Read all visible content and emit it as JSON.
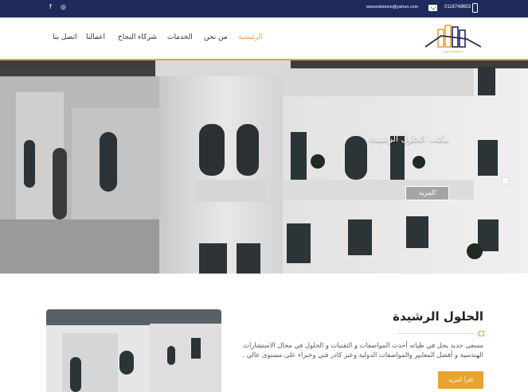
{
  "topbar": {
    "email": "wisesolutions@yahoo.com",
    "phone": "0116748653",
    "social": [
      {
        "icon": "facebook-icon",
        "glyph": "f"
      },
      {
        "icon": "instagram-icon",
        "glyph": "◎"
      }
    ],
    "colors": {
      "background": "#1e2a5c"
    }
  },
  "header": {
    "logo_text": "wise solutions",
    "nav": [
      {
        "label": "الرئيسية",
        "active": true
      },
      {
        "label": "من نحن",
        "active": false
      },
      {
        "label": "الخدمات",
        "active": false
      },
      {
        "label": "شركاء النجاح",
        "active": false
      },
      {
        "label": "اعمالنا",
        "active": false
      },
      {
        "label": "اتصل بنا",
        "active": false
      }
    ],
    "colors": {
      "accent": "#e9a330"
    }
  },
  "hero": {
    "title": "مكتب الحلول الرشيدة",
    "button_label": "المزيد"
  },
  "about": {
    "title": "الحلول الرشيدة",
    "text": "مسعى جديد يحل في طياته أحدث المواصفات و التقنيات و الحلول في مجال الاستشارات الهندسية و أفضل المعايير والمواصفات الدولية وعبر كادر فني وخبراء على مستوى عالي .",
    "button_label": "اقرأ المزيد"
  }
}
